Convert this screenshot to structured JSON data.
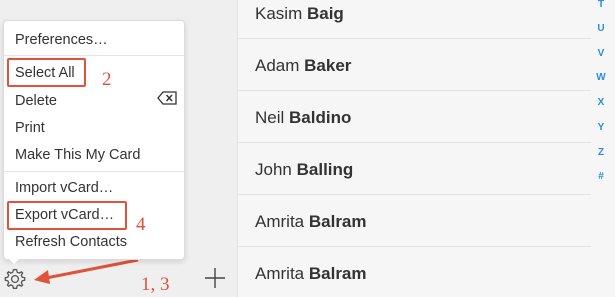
{
  "menu": {
    "items": [
      {
        "label": "Preferences…"
      },
      {
        "label": "Select All"
      },
      {
        "label": "Delete"
      },
      {
        "label": "Print"
      },
      {
        "label": "Make This My Card"
      },
      {
        "label": "Import vCard…"
      },
      {
        "label": "Export vCard…"
      },
      {
        "label": "Refresh Contacts"
      }
    ]
  },
  "annotations": {
    "step_select_all": "2",
    "step_export": "4",
    "step_gear": "1, 3"
  },
  "contacts": [
    {
      "first": "Kasim",
      "last": "Baig"
    },
    {
      "first": "Adam",
      "last": "Baker"
    },
    {
      "first": "Neil",
      "last": "Baldino"
    },
    {
      "first": "John",
      "last": "Balling"
    },
    {
      "first": "Amrita",
      "last": "Balram"
    },
    {
      "first": "Amrita",
      "last": "Balram"
    }
  ],
  "index_letters": [
    "T",
    "U",
    "V",
    "W",
    "X",
    "Y",
    "Z",
    "#"
  ],
  "colors": {
    "annotation_red": "#e0523a",
    "index_blue": "#2b8de0"
  },
  "icons": {
    "settings": "gear-icon",
    "add": "plus-icon",
    "delete_key": "backspace-icon"
  }
}
